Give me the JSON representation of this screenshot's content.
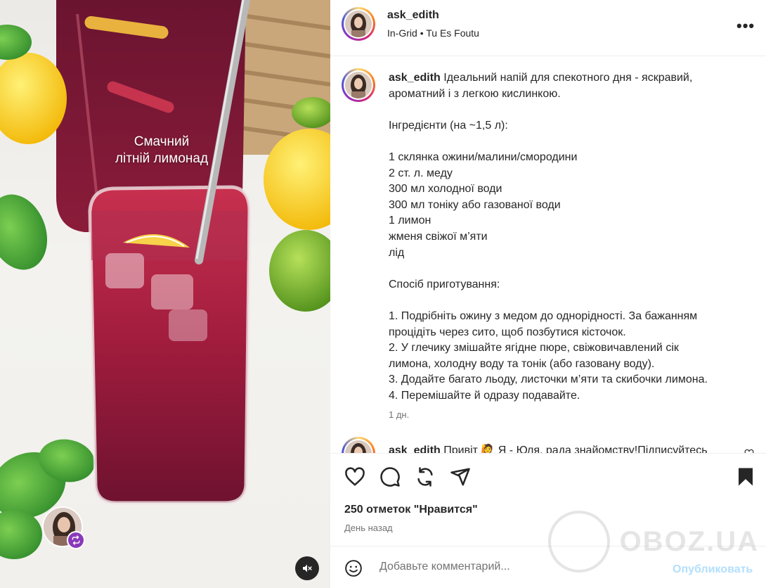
{
  "media": {
    "overlay_line1": "Смачний",
    "overlay_line2": "літній лимонад",
    "mute_icon": "speaker-muted-icon",
    "repost_icon": "repost-icon"
  },
  "header": {
    "username": "ask_edith",
    "audio_artist": "In-Grid",
    "audio_separator": "•",
    "audio_title": "Tu Es Foutu",
    "more_label": "•••"
  },
  "caption": {
    "username": "ask_edith",
    "lines": [
      "Ідеальний напій для спекотного дня - яскравий,",
      "ароматний і з легкою кислинкою.",
      "",
      "Інгредієнти (на ~1,5 л):",
      "",
      "1 склянка ожини/малини/смородини",
      "2 ст. л. меду",
      "300 мл холодної води",
      "300 мл тоніку або газованої води",
      "1 лимон",
      "жменя свіжої м’яти",
      "лід",
      "",
      "Спосіб приготування:",
      "",
      "1. Подрібніть ожину з медом до однорідності. За бажанням",
      "процідіть через сито, щоб позбутися кісточок.",
      "2. У глечику змішайте ягідне пюре, свіжовичавлений сік",
      "лимона, холодну воду та тонік (або газовану воду).",
      "3. Додайте багато льоду, листочки м’яти та скибочки лимона.",
      "4. Перемішайте й одразу подавайте."
    ],
    "time": "1 дн."
  },
  "comment2": {
    "username": "ask_edith",
    "text": "Привіт 🙋 Я - Юля, рада знайомству!Підписуйтесь"
  },
  "actions": {
    "like_icon": "heart-icon",
    "comment_icon": "comment-icon",
    "share_icon": "repost-icon",
    "send_icon": "send-icon",
    "save_icon": "bookmark-icon",
    "likes_text": "250 отметок \"Нравится\"",
    "posted_ago": "День назад"
  },
  "add_comment": {
    "emoji_icon": "smiley-icon",
    "placeholder": "Добавьте комментарий...",
    "publish_label": "Опубликовать"
  },
  "watermark": {
    "text": "OBOZ.UA"
  },
  "colors": {
    "publish_disabled": "#b2dffc",
    "secondary_text": "#737373",
    "divider": "#efefef",
    "drink": "#b02040"
  }
}
